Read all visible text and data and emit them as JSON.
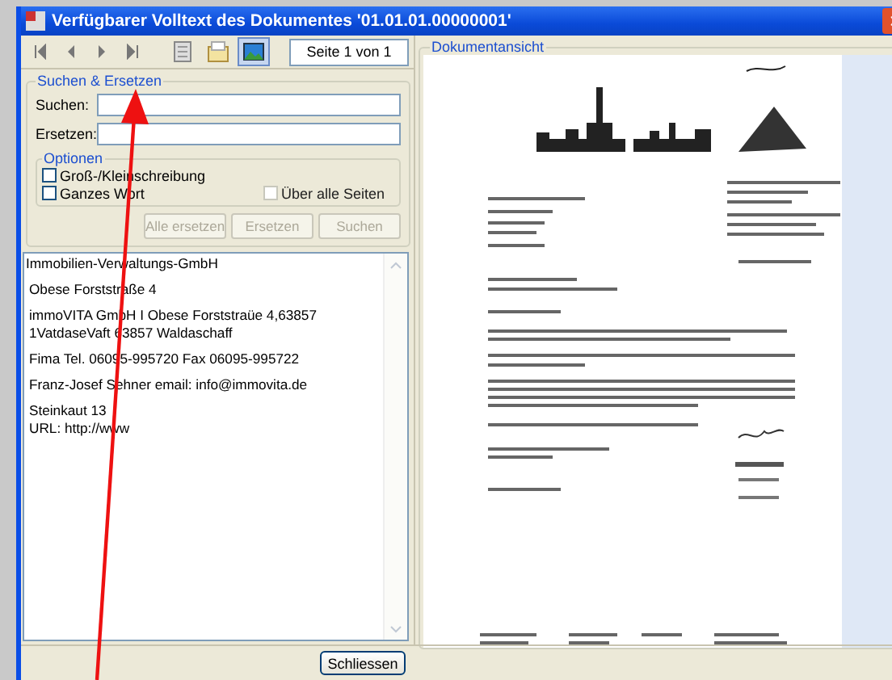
{
  "window": {
    "title": "Verfügbarer Volltext des Dokumentes '01.01.01.00000001'"
  },
  "toolbar": {
    "nav_buttons": [
      {
        "kind": "first"
      },
      {
        "kind": "prev"
      },
      {
        "kind": "next"
      },
      {
        "kind": "last"
      }
    ],
    "tools": [
      {
        "kind": "page",
        "pressed": false
      },
      {
        "kind": "open",
        "pressed": false
      },
      {
        "kind": "image",
        "pressed": true
      }
    ],
    "page_indicator": "Seite 1 von 1"
  },
  "search_group": {
    "title": "Suchen & Ersetzen",
    "fields": [
      {
        "label": "Suchen:"
      },
      {
        "label": "Ersetzen:"
      }
    ],
    "options": {
      "title": "Optionen",
      "checkboxes": [
        {
          "label": "Groß-/Kleinschreibung",
          "checked": false,
          "disabled": false
        },
        {
          "label": "Ganzes Wort",
          "checked": false,
          "disabled": false
        },
        {
          "label": "Über alle Seiten",
          "checked": false,
          "disabled": true
        }
      ]
    },
    "buttons": [
      {
        "label": "Alle ersetzen",
        "disabled": true
      },
      {
        "label": "Ersetzen",
        "disabled": true
      },
      {
        "label": "Suchen",
        "disabled": true
      }
    ]
  },
  "text_lines": [
    "Immobilien-Verwaltungs-GmbH",
    "Obese Forststraße 4",
    "immoVITA GmbH I Obese Forststraüe 4,63857 1VatdaseVaft 63857 Waldaschaff",
    "Fima Tel. 06095-995720 Fax 06095-995722",
    "Franz-Josef Sehner email: info@immovita.de",
    "Steinkaut 13\nURL: http://www"
  ],
  "preview": {
    "title": "Dokumentansicht"
  },
  "footer": {
    "close_button": "Schliessen"
  }
}
